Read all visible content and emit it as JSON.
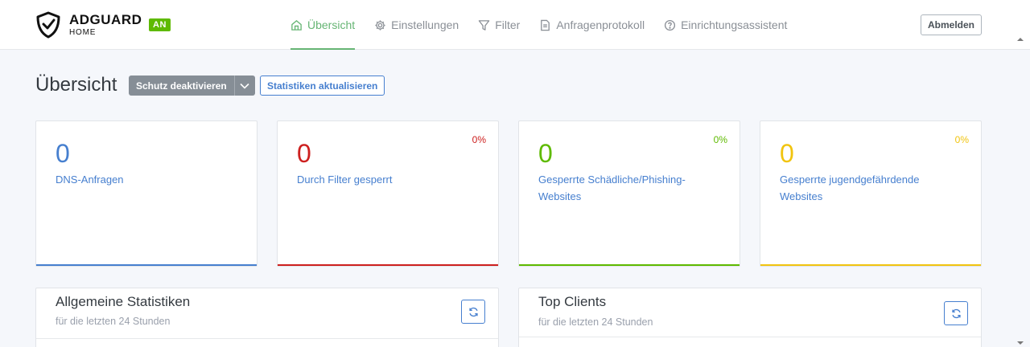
{
  "header": {
    "brand": "ADGUARD",
    "brand_sub": "HOME",
    "status_badge": "AN",
    "nav": [
      {
        "label": "Übersicht",
        "icon": "home-icon",
        "active": true
      },
      {
        "label": "Einstellungen",
        "icon": "gear-icon",
        "active": false
      },
      {
        "label": "Filter",
        "icon": "filter-icon",
        "active": false
      },
      {
        "label": "Anfragenprotokoll",
        "icon": "file-icon",
        "active": false
      },
      {
        "label": "Einrichtungsassistent",
        "icon": "help-circle-icon",
        "active": false
      }
    ],
    "logout_label": "Abmelden"
  },
  "page": {
    "title": "Übersicht",
    "protect_button": "Schutz deaktivieren",
    "refresh_stats_button": "Statistiken aktualisieren"
  },
  "cards": [
    {
      "value": "0",
      "label": "DNS-Anfragen",
      "percent": "",
      "color": "#467fcf"
    },
    {
      "value": "0",
      "label": "Durch Filter gesperrt",
      "percent": "0%",
      "color": "#cd201f"
    },
    {
      "value": "0",
      "label": "Gesperrte Schädliche/Phishing-Websites",
      "percent": "0%",
      "color": "#5eba00"
    },
    {
      "value": "0",
      "label": "Gesperrte jugendgefährdende Websites",
      "percent": "0%",
      "color": "#f1c40f"
    }
  ],
  "panels": {
    "general_stats": {
      "title": "Allgemeine Statistiken",
      "subtitle": "für die letzten 24 Stunden"
    },
    "top_clients": {
      "title": "Top Clients",
      "subtitle": "für die letzten 24 Stunden"
    }
  },
  "colors": {
    "accent_green": "#66b574",
    "link_blue": "#467fcf",
    "danger_red": "#cd201f",
    "success_green": "#5eba00",
    "warning_yellow": "#f1c40f"
  }
}
